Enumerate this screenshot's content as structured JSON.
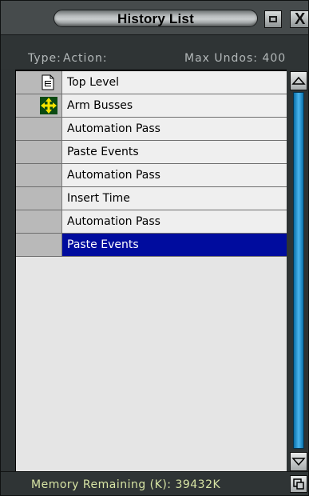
{
  "window": {
    "title": "History List",
    "close_glyph": "X"
  },
  "header": {
    "type_label": "Type:",
    "action_label": "Action:",
    "max_undos_label": "Max Undos:",
    "max_undos_value": "400"
  },
  "history": [
    {
      "action": "Top Level",
      "icon": "document-icon",
      "selected": false
    },
    {
      "action": "Arm Busses",
      "icon": "move-arrows-icon",
      "selected": false
    },
    {
      "action": "Automation Pass",
      "icon": "",
      "selected": false
    },
    {
      "action": "Paste Events",
      "icon": "",
      "selected": false
    },
    {
      "action": "Automation Pass",
      "icon": "",
      "selected": false
    },
    {
      "action": "Insert Time",
      "icon": "",
      "selected": false
    },
    {
      "action": "Automation Pass",
      "icon": "",
      "selected": false
    },
    {
      "action": "Paste Events",
      "icon": "",
      "selected": true
    }
  ],
  "footer": {
    "memory_label": "Memory Remaining (K):",
    "memory_value": "39432K"
  },
  "colors": {
    "selection": "#000c9e",
    "scroll_track": "#49b6f0",
    "memory_text": "#d7e4a4"
  }
}
